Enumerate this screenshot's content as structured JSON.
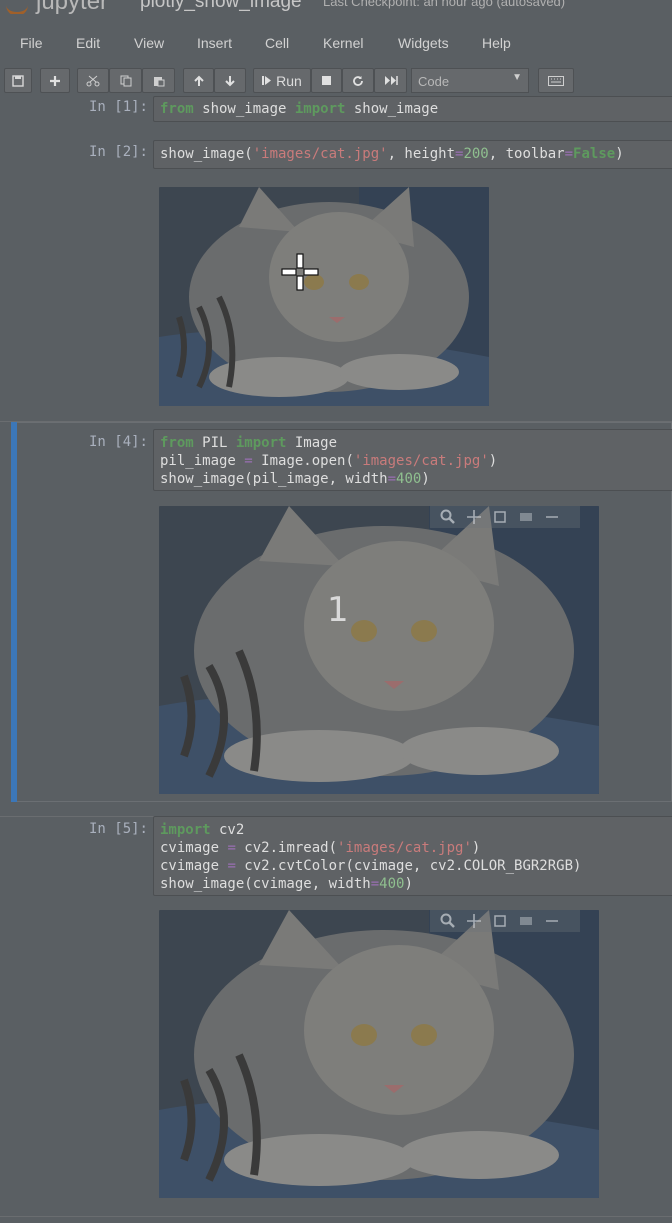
{
  "header": {
    "logo_text": "jupyter",
    "notebook_title": "plotly_show_image",
    "checkpoint": "Last Checkpoint: an hour ago",
    "autosave": "(autosaved)"
  },
  "menu": [
    "File",
    "Edit",
    "View",
    "Insert",
    "Cell",
    "Kernel",
    "Widgets",
    "Help"
  ],
  "toolbar": {
    "run_label": "Run",
    "cell_type": "Code",
    "icons": [
      "save-icon",
      "plus-icon",
      "cut-icon",
      "copy-icon",
      "paste-icon",
      "arrow-up-icon",
      "arrow-down-icon",
      "run-icon",
      "stop-icon",
      "restart-icon",
      "fast-forward-icon",
      "keyboard-icon"
    ]
  },
  "cells": [
    {
      "prompt": "In [1]:",
      "code": "from show_image import show_image"
    },
    {
      "prompt": "In [2]:",
      "code": "show_image('images/cat.jpg', height=200, toolbar=False)"
    },
    {
      "prompt": "In [4]:",
      "code": "from PIL import Image\npil_image = Image.open('images/cat.jpg')\nshow_image(pil_image, width=400)"
    },
    {
      "prompt": "In [5]:",
      "code": "import cv2\ncvimage = cv2.imread('images/cat.jpg')\ncvimage = cv2.cvtColor(cvimage, cv2.COLOR_BGR2RGB)\nshow_image(cvimage, width=400)"
    }
  ],
  "overlay_counter": "1",
  "colors": {
    "accent": "#3c77b8",
    "background": "#5a5f63",
    "keyword": "#5e9a5e",
    "string": "#c97b7b"
  }
}
